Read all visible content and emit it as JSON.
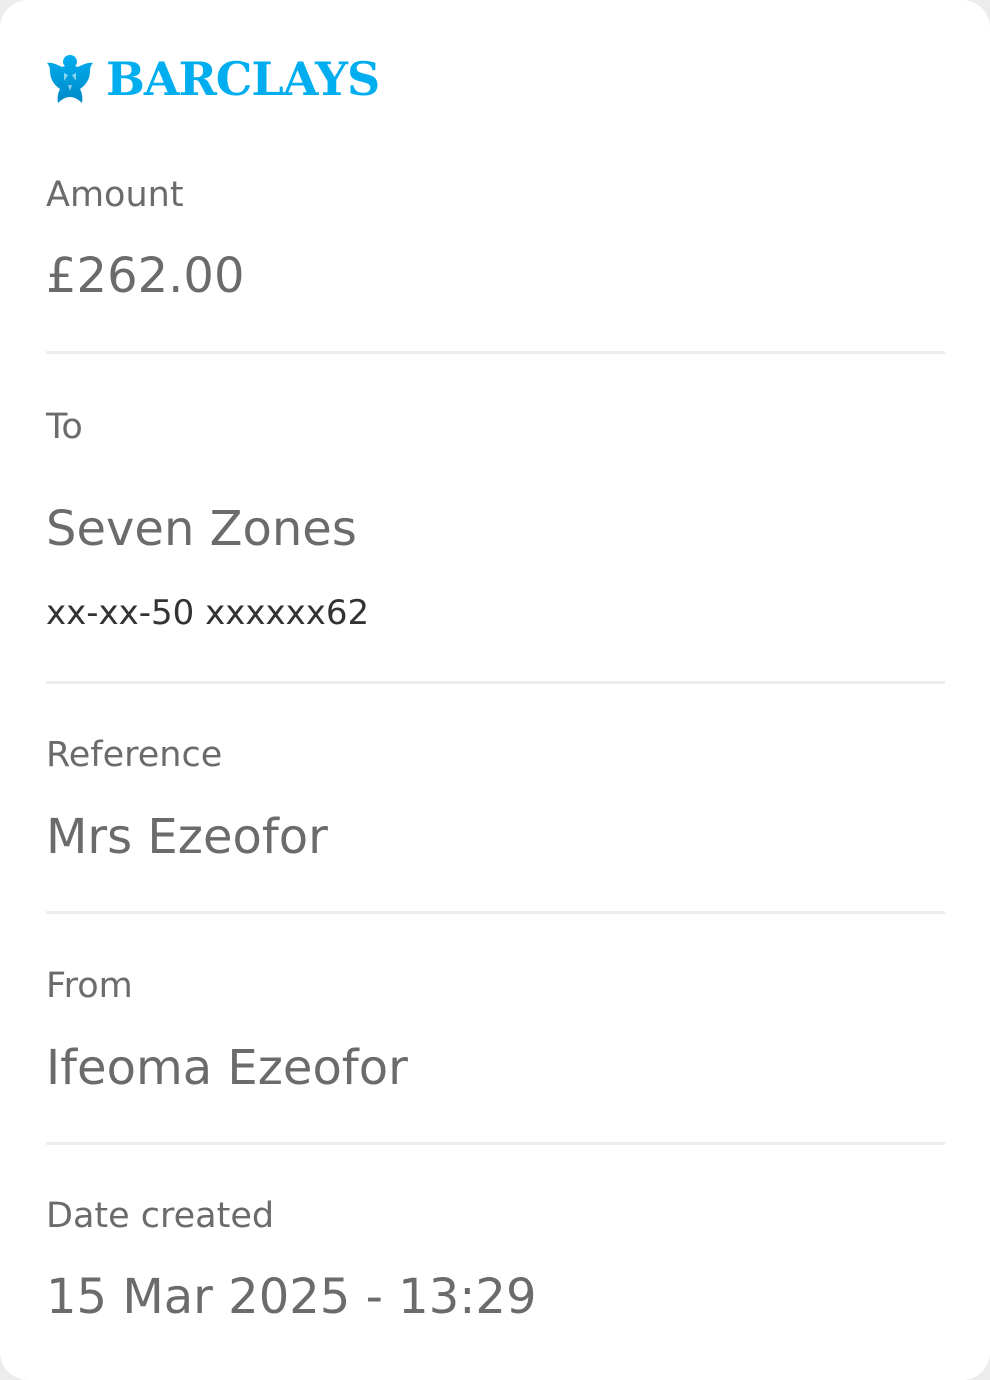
{
  "brand": {
    "name": "BARCLAYS",
    "icon": "eagle-icon",
    "color": "#00aeef"
  },
  "details": {
    "amount": {
      "label": "Amount",
      "value": "£262.00"
    },
    "to": {
      "label": "To",
      "value": "Seven Zones",
      "account": "xx-xx-50 xxxxxx62"
    },
    "reference": {
      "label": "Reference",
      "value": "Mrs Ezeofor"
    },
    "from": {
      "label": "From",
      "value": "Ifeoma Ezeofor"
    },
    "date_created": {
      "label": "Date created",
      "value": "15 Mar 2025 - 13:29"
    }
  },
  "colors": {
    "text": "#6b6b6b",
    "account_text": "#333333",
    "divider": "#ededed",
    "background": "#ffffff"
  }
}
